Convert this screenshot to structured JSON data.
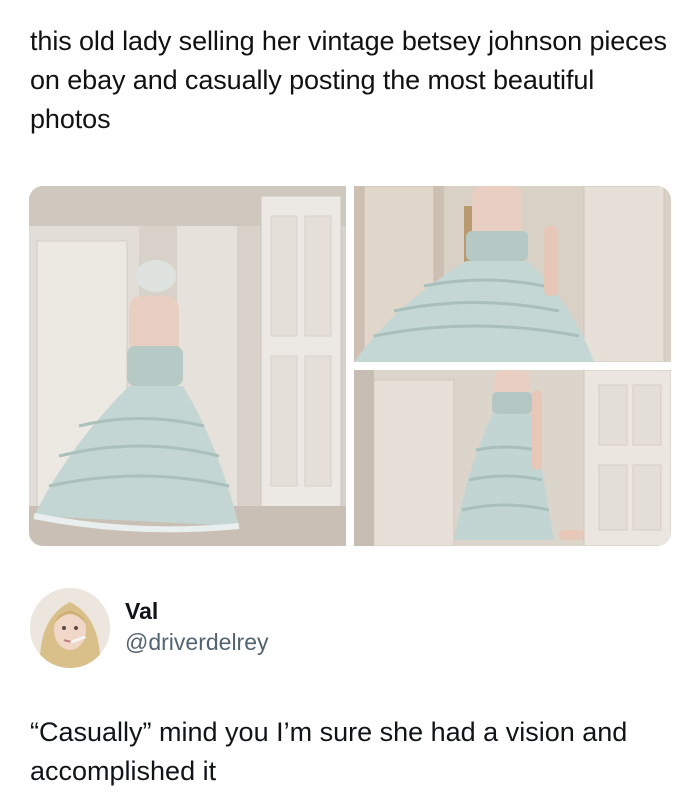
{
  "post": {
    "caption": "this old lady selling her vintage betsey johnson pieces on ebay and casually posting the most beautiful photos"
  },
  "photos": [
    {
      "name": "dress-photo-full-back"
    },
    {
      "name": "dress-photo-skirt-closeup"
    },
    {
      "name": "dress-photo-side"
    }
  ],
  "reply": {
    "display_name": "Val",
    "handle": "@driverdelrey",
    "text": "“Casually” mind you I’m sure she had a vision and accomplished it"
  }
}
